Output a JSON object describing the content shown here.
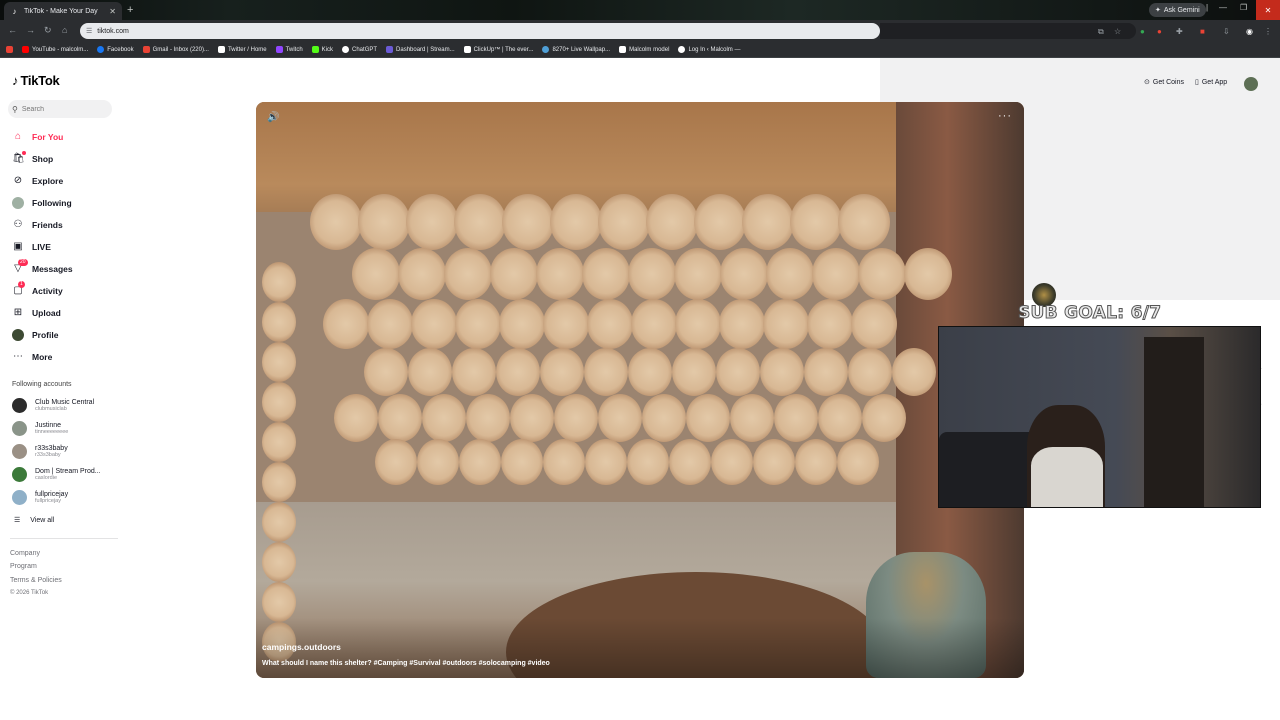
{
  "browser": {
    "tab_title": "TikTok - Make Your Day",
    "new_tab": "+",
    "ask_gemini": "Ask Gemini",
    "url": "tiktok.com",
    "bookmarks": [
      {
        "label": "YouTube - malcolm...",
        "color": "#ff0000"
      },
      {
        "label": "Facebook",
        "color": "#1877f2"
      },
      {
        "label": "Gmail - Inbox (220)...",
        "color": "#ea4335"
      },
      {
        "label": "Twitter / Home",
        "color": "#ffffff"
      },
      {
        "label": "Twitch",
        "color": "#9146ff"
      },
      {
        "label": "Kick",
        "color": "#53fc18"
      },
      {
        "label": "ChatGPT",
        "color": "#ffffff"
      },
      {
        "label": "Dashboard | Stream...",
        "color": "#6b5bd6"
      },
      {
        "label": "ClickUp™ | The ever...",
        "color": "#ffffff"
      },
      {
        "label": "8270+ Live Wallpap...",
        "color": "#4f9fd6"
      },
      {
        "label": "Malcolm model",
        "color": "#ffffff"
      },
      {
        "label": "Log In ‹ Malcolm —",
        "color": "#ffffff"
      }
    ]
  },
  "tiktok": {
    "logo": "TikTok",
    "search_placeholder": "Search",
    "nav": [
      {
        "label": "For You",
        "icon": "home-icon",
        "active": true
      },
      {
        "label": "Shop",
        "icon": "shop-icon"
      },
      {
        "label": "Explore",
        "icon": "compass-icon"
      },
      {
        "label": "Following",
        "icon": "avatar-icon"
      },
      {
        "label": "Friends",
        "icon": "friends-icon"
      },
      {
        "label": "LIVE",
        "icon": "live-icon"
      },
      {
        "label": "Messages",
        "icon": "messages-icon",
        "badge": "20"
      },
      {
        "label": "Activity",
        "icon": "activity-icon",
        "badge": "1"
      },
      {
        "label": "Upload",
        "icon": "upload-icon"
      },
      {
        "label": "Profile",
        "icon": "profile-icon"
      },
      {
        "label": "More",
        "icon": "more-icon"
      }
    ],
    "following_title": "Following accounts",
    "accounts": [
      {
        "name": "Club Music Central",
        "handle": "clubmusiclab"
      },
      {
        "name": "Justinne",
        "handle": "tinneeeeeeee"
      },
      {
        "name": "r33s3baby",
        "handle": "r33s3baby"
      },
      {
        "name": "Dom | Stream Prod...",
        "handle": "caslordie"
      },
      {
        "name": "fullpricejay",
        "handle": "fullpricejay"
      }
    ],
    "view_all": "View all",
    "footer": [
      "Company",
      "Program",
      "Terms & Policies",
      "© 2026 TikTok"
    ],
    "get_coins": "Get Coins",
    "get_app": "Get App",
    "video": {
      "author": "campings.outdoors",
      "description": "What should I name this shelter? #Camping #Survival #outdoors #solocamping #video"
    }
  },
  "overlay": {
    "sub_goal": "SUB GOAL: 6/7"
  }
}
